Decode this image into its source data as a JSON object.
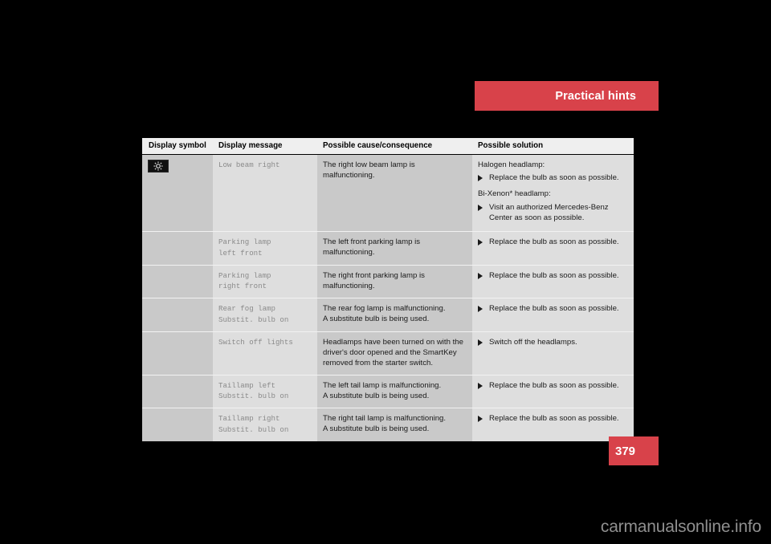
{
  "banner": {
    "label": "Practical hints",
    "color": "#d8424a"
  },
  "page_number": {
    "label": "379",
    "color": "#d8424a"
  },
  "watermark": {
    "text": "carmanualsonline.info"
  },
  "table": {
    "headers": [
      "Display symbol",
      "Display message",
      "Possible cause/consequence",
      "Possible solution"
    ],
    "rows": [
      {
        "symbol": "headlamp-indicator-icon",
        "message": "Low beam right",
        "cause": "The right low beam lamp is\nmalfunctioning.",
        "solution_groups": [
          {
            "heading": "Halogen headlamp:",
            "items": [
              "Replace the bulb as soon as possible."
            ]
          },
          {
            "heading": "Bi-Xenon* headlamp:",
            "items": [
              "Visit an authorized Mercedes-Benz Center as soon as possible."
            ]
          }
        ]
      },
      {
        "symbol": null,
        "message": "Parking lamp\nleft front",
        "cause": "The left front parking lamp is\nmalfunctioning.",
        "solution_groups": [
          {
            "heading": null,
            "items": [
              "Replace the bulb as soon as possible."
            ]
          }
        ]
      },
      {
        "symbol": null,
        "message": "Parking lamp\nright front",
        "cause": "The right front parking lamp is\nmalfunctioning.",
        "solution_groups": [
          {
            "heading": null,
            "items": [
              "Replace the bulb as soon as possible."
            ]
          }
        ]
      },
      {
        "symbol": null,
        "message": "Rear fog lamp\nSubstit. bulb on",
        "cause": "The rear fog lamp is malfunctioning.\nA substitute bulb is being used.",
        "solution_groups": [
          {
            "heading": null,
            "items": [
              "Replace the bulb as soon as possible."
            ]
          }
        ]
      },
      {
        "symbol": null,
        "message": "Switch off lights",
        "cause": "Headlamps have been turned on with the driver's door opened and the SmartKey removed from the starter switch.",
        "solution_groups": [
          {
            "heading": null,
            "items": [
              "Switch off the headlamps."
            ]
          }
        ]
      },
      {
        "symbol": null,
        "message": "Taillamp left\nSubstit. bulb on",
        "cause": "The left tail lamp is malfunctioning.\nA substitute bulb is being used.",
        "solution_groups": [
          {
            "heading": null,
            "items": [
              "Replace the bulb as soon as possible."
            ]
          }
        ]
      },
      {
        "symbol": null,
        "message": "Taillamp right\nSubstit. bulb on",
        "cause": "The right tail lamp is malfunctioning.\nA substitute bulb is being used.",
        "solution_groups": [
          {
            "heading": null,
            "items": [
              "Replace the bulb as soon as possible."
            ]
          }
        ]
      }
    ]
  }
}
